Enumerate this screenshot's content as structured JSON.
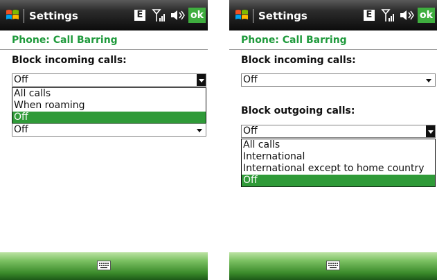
{
  "left": {
    "titlebar": {
      "title": "Settings",
      "e_label": "E",
      "ok_label": "ok",
      "icons": [
        "windows-logo-icon",
        "signal-icon",
        "speaker-icon"
      ]
    },
    "page_title": "Phone: Call Barring",
    "incoming": {
      "label": "Block incoming calls:",
      "value": "Off",
      "open": true,
      "options": [
        "All calls",
        "When roaming",
        "Off"
      ],
      "selected": "Off"
    },
    "outgoing": {
      "value": "Off"
    },
    "bottombar": {
      "icon": "keyboard-icon"
    }
  },
  "right": {
    "titlebar": {
      "title": "Settings",
      "e_label": "E",
      "ok_label": "ok",
      "icons": [
        "windows-logo-icon",
        "signal-icon",
        "speaker-icon"
      ]
    },
    "page_title": "Phone: Call Barring",
    "incoming": {
      "label": "Block incoming calls:",
      "value": "Off"
    },
    "outgoing": {
      "label": "Block outgoing calls:",
      "value": "Off",
      "open": true,
      "options": [
        "All calls",
        "International",
        "International except to home country",
        "Off"
      ],
      "selected": "Off"
    },
    "bottombar": {
      "icon": "keyboard-icon"
    }
  },
  "colors": {
    "accent_green": "#2f9a38",
    "title_green": "#1f9a3c",
    "ok_green": "#3fae3f"
  }
}
